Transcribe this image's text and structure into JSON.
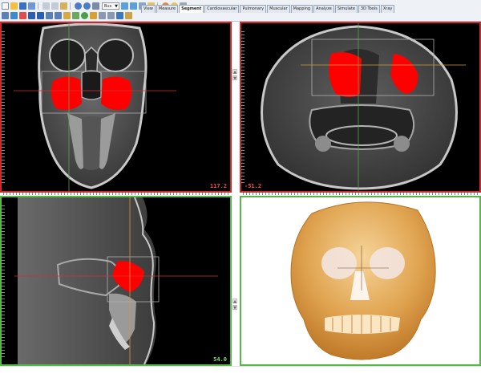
{
  "toolbar": {
    "combo_value": "Bus",
    "tabs": [
      {
        "label": "View",
        "active": false
      },
      {
        "label": "Measure",
        "active": false
      },
      {
        "label": "Segment",
        "active": true
      },
      {
        "label": "Cardiovascular",
        "active": false
      },
      {
        "label": "Pulmonary",
        "active": false
      },
      {
        "label": "Muscular",
        "active": false
      },
      {
        "label": "Mapping",
        "active": false
      },
      {
        "label": "Analyze",
        "active": false
      },
      {
        "label": "Simulate",
        "active": false
      },
      {
        "label": "3D Tools",
        "active": false
      },
      {
        "label": "Xray",
        "active": false
      }
    ]
  },
  "viewers": {
    "coronal": {
      "value": "117.2",
      "border_color": "#cc2a2a"
    },
    "axial": {
      "value": "-51.2",
      "border_color": "#cc2a2a"
    },
    "sagittal": {
      "value": "54.0",
      "border_color": "#57b847"
    },
    "volume_3d": {
      "border_color": "#57b847"
    }
  },
  "colors": {
    "segment": "#ff0000",
    "value_red": "#ff4a4a",
    "value_green": "#7fe06a",
    "crosshair_red": "#d03030",
    "crosshair_green": "#5aa050",
    "crosshair_orange": "#d29a3a"
  }
}
